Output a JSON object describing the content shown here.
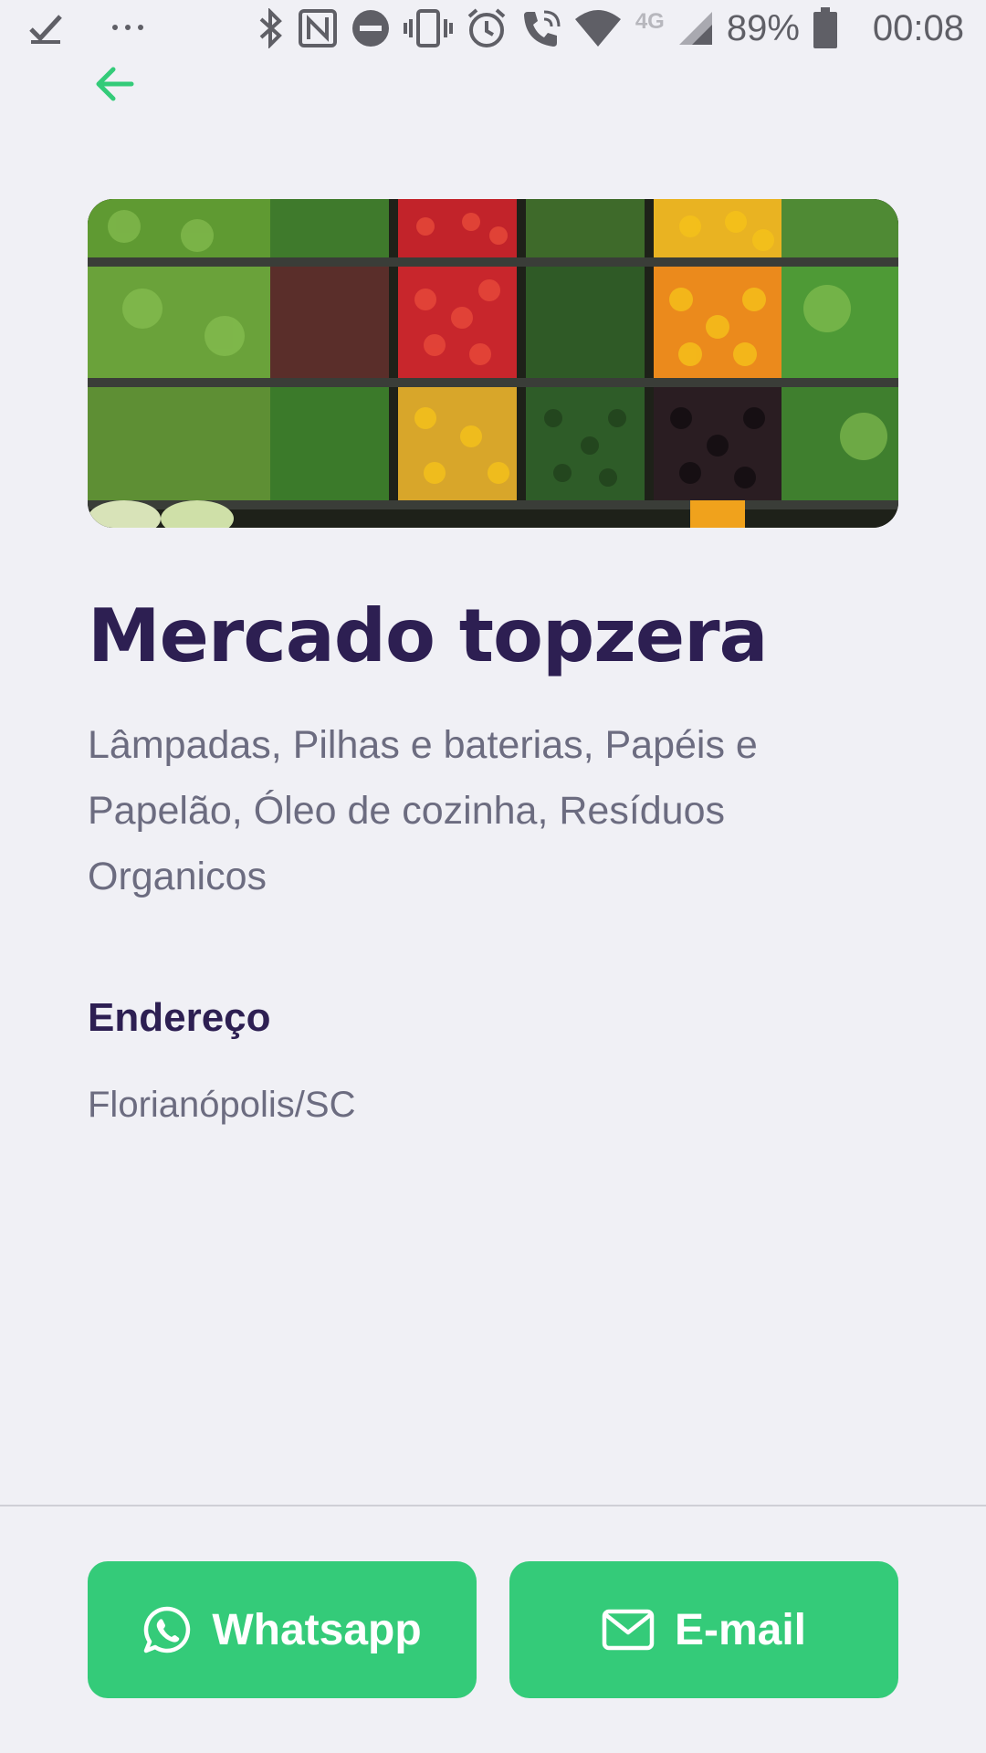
{
  "status_bar": {
    "network": "4G",
    "battery": "89%",
    "time": "00:08",
    "icons": [
      "download-done-icon",
      "more-icon",
      "bluetooth-icon",
      "nfc-icon",
      "dnd-icon",
      "vibrate-icon",
      "alarm-icon",
      "wifi-call-icon",
      "wifi-icon",
      "signal-icon",
      "battery-icon"
    ]
  },
  "header": {
    "back_icon": "arrow-left-icon"
  },
  "point": {
    "name": "Mercado topzera",
    "items": "Lâmpadas, Pilhas e baterias, Papéis e Papelão, Óleo de cozinha, Resíduos Organicos",
    "address_label": "Endereço",
    "address": "Florianópolis/SC"
  },
  "footer": {
    "whatsapp_label": "Whatsapp",
    "email_label": "E-mail"
  },
  "colors": {
    "accent": "#34CB79",
    "title": "#2D1F52",
    "text": "#6C6C80",
    "background": "#F0F0F5"
  }
}
